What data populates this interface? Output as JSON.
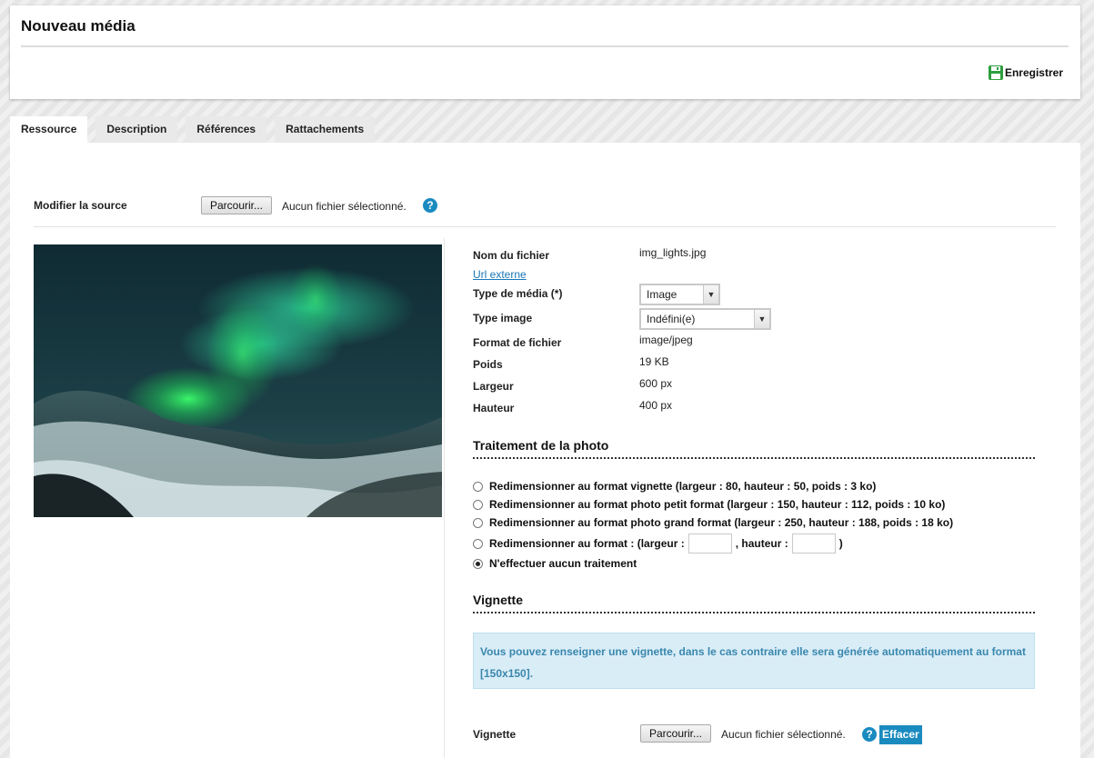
{
  "header": {
    "title": "Nouveau média",
    "save_label": "Enregistrer"
  },
  "tabs": [
    {
      "label": "Ressource",
      "active": true
    },
    {
      "label": "Description",
      "active": false
    },
    {
      "label": "Références",
      "active": false
    },
    {
      "label": "Rattachements",
      "active": false
    }
  ],
  "source": {
    "label": "Modifier la source",
    "browse_label": "Parcourir...",
    "no_file_text": "Aucun fichier sélectionné.",
    "help_icon": "question-circle-icon"
  },
  "details": {
    "filename_label": "Nom du fichier",
    "filename_value": "img_lights.jpg",
    "external_url_link": "Url externe",
    "media_type_label": "Type de média (*)",
    "media_type_value": "Image",
    "image_type_label": "Type image",
    "image_type_value": "Indéfini(e)",
    "file_format_label": "Format de fichier",
    "file_format_value": "image/jpeg",
    "weight_label": "Poids",
    "weight_value": "19 KB",
    "width_label": "Largeur",
    "width_value": "600 px",
    "height_label": "Hauteur",
    "height_value": "400 px"
  },
  "processing": {
    "title": "Traitement de la photo",
    "options": [
      {
        "label": "Redimensionner au format vignette (largeur : 80, hauteur : 50, poids : 3 ko)",
        "checked": false
      },
      {
        "label": "Redimensionner au format photo petit format (largeur : 150, hauteur : 112, poids : 10 ko)",
        "checked": false
      },
      {
        "label": "Redimensionner au format photo grand format (largeur : 250, hauteur : 188, poids : 18 ko)",
        "checked": false
      },
      {
        "label": "N'effectuer aucun traitement",
        "checked": true
      }
    ],
    "custom_prefix": "Redimensionner au format : (largeur :",
    "custom_mid": ", hauteur :",
    "custom_suffix": ")",
    "custom_checked": false
  },
  "thumbnail": {
    "title": "Vignette",
    "info_text": "Vous pouvez renseigner une vignette, dans le cas contraire elle sera générée automatiquement au format [150x150].",
    "label": "Vignette",
    "browse_label": "Parcourir...",
    "no_file_text": "Aucun fichier sélectionné.",
    "clear_label": "Effacer"
  },
  "colors": {
    "accent": "#1a8bbf",
    "save_icon": "#2e9e3e",
    "info_bg": "#d9edf7",
    "info_text": "#3a87ad",
    "link": "#1a77b8"
  }
}
